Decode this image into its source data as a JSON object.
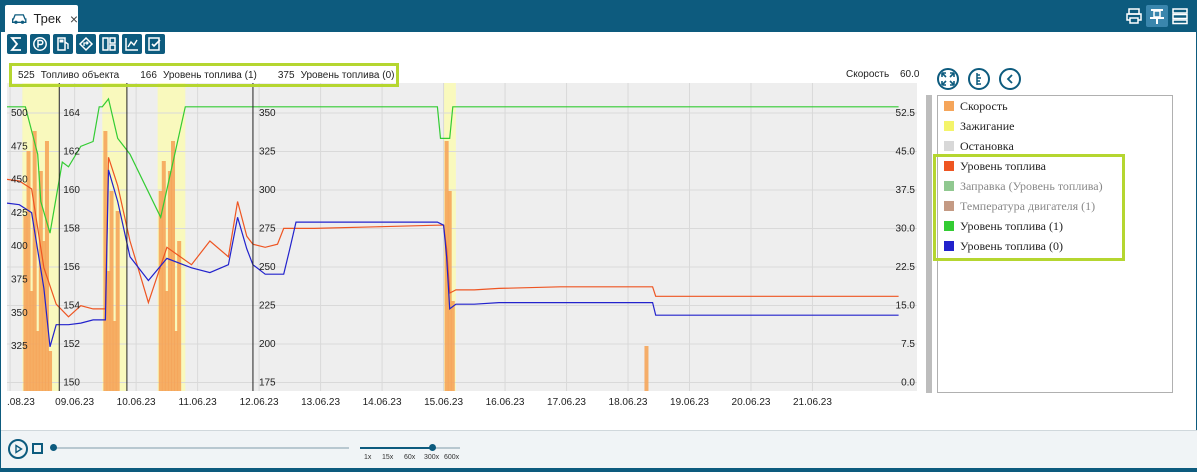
{
  "tab": {
    "title": "Трек",
    "close": "×"
  },
  "toolbar": {
    "buttons": [
      "sum-icon",
      "parking-icon",
      "fuel-icon",
      "route-icon",
      "layout-icon",
      "chart-icon",
      "report-icon"
    ]
  },
  "top_buttons": [
    "print-icon",
    "pin-icon",
    "list-icon"
  ],
  "top_legend": [
    {
      "value": "525",
      "label": "Топливо объекта"
    },
    {
      "value": "166",
      "label": "Уровень топлива (1)"
    },
    {
      "value": "375",
      "label": "Уровень топлива (0)"
    }
  ],
  "speed_axis_label": "Скорость",
  "speed_axis_max": "60.0",
  "panel_buttons": [
    "expand-icon",
    "scale-icon",
    "back-icon"
  ],
  "legend_items": [
    {
      "label": "Скорость",
      "color": "#f5a55a",
      "dim": false
    },
    {
      "label": "Зажигание",
      "color": "#f4f46a",
      "dim": false
    },
    {
      "label": "Остановка",
      "color": "#d8d8d8",
      "dim": false
    },
    {
      "label": "Уровень топлива",
      "color": "#ee5522",
      "dim": false
    },
    {
      "label": "Заправка (Уровень топлива)",
      "color": "#90c890",
      "dim": true
    },
    {
      "label": "Температура двигателя (1)",
      "color": "#c49a84",
      "dim": true
    },
    {
      "label": "Уровень топлива (1)",
      "color": "#33cc33",
      "dim": false
    },
    {
      "label": "Уровень топлива (0)",
      "color": "#2222cc",
      "dim": false
    }
  ],
  "player": {
    "speed_options": [
      "1x",
      "15x",
      "60x",
      "300x",
      "600x"
    ],
    "selected_speed": "300x"
  },
  "chart_data": {
    "type": "line",
    "x_tick_labels": [
      ".08.23",
      "09.06.23",
      "10.06.23",
      "11.06.23",
      "12.06.23",
      "13.06.23",
      "14.06.23",
      "15.06.23",
      "16.06.23",
      "17.06.23",
      "18.06.23",
      "19.06.23",
      "20.06.23",
      "21.06.23"
    ],
    "axes": [
      {
        "name": "Топливо объекта",
        "ticks": [
          "500",
          "475",
          "450",
          "425",
          "400",
          "375",
          "350",
          "325"
        ],
        "ylim": [
          320,
          510
        ]
      },
      {
        "name": "Уровень топлива (1)",
        "ticks": [
          "164",
          "162",
          "160",
          "158",
          "156",
          "154",
          "152",
          "150"
        ],
        "ylim": [
          149.5,
          165
        ]
      },
      {
        "name": "Уровень топлива (0)",
        "ticks": [
          "350",
          "325",
          "300",
          "275",
          "250",
          "225",
          "200",
          "175"
        ],
        "ylim": [
          170,
          360
        ]
      },
      {
        "name": "Скорость",
        "ticks": [
          "52.5",
          "45.0",
          "37.5",
          "30.0",
          "22.5",
          "15.0",
          "7.5",
          "0.0"
        ],
        "ylim": [
          0,
          60
        ]
      }
    ],
    "series": [
      {
        "name": "Уровень топлива",
        "color": "#ee5522",
        "axis": 2,
        "points": [
          [
            0,
            304
          ],
          [
            0.2,
            303
          ],
          [
            0.4,
            298
          ],
          [
            0.6,
            248
          ],
          [
            0.8,
            225
          ],
          [
            1.0,
            217
          ],
          [
            1.2,
            224
          ],
          [
            1.4,
            222
          ],
          [
            1.6,
            222
          ],
          [
            1.65,
            318
          ],
          [
            1.8,
            300
          ],
          [
            2.0,
            265
          ],
          [
            2.3,
            226
          ],
          [
            2.6,
            261
          ],
          [
            3.0,
            250
          ],
          [
            3.3,
            265
          ],
          [
            3.6,
            255
          ],
          [
            3.75,
            290
          ],
          [
            3.9,
            268
          ],
          [
            4.0,
            263
          ],
          [
            4.2,
            261
          ],
          [
            4.4,
            263
          ],
          [
            4.5,
            273
          ],
          [
            4.6,
            273
          ],
          [
            5.0,
            273
          ],
          [
            6.0,
            274
          ],
          [
            7.0,
            275
          ],
          [
            7.1,
            275
          ],
          [
            7.15,
            260
          ],
          [
            7.2,
            232
          ],
          [
            7.3,
            234
          ],
          [
            7.6,
            234
          ],
          [
            8.0,
            235
          ],
          [
            9.0,
            236
          ],
          [
            10.0,
            236
          ],
          [
            10.5,
            236
          ],
          [
            10.55,
            230
          ],
          [
            11.0,
            230
          ],
          [
            12.0,
            230
          ],
          [
            13.0,
            230
          ],
          [
            14.0,
            230
          ],
          [
            14.5,
            230
          ]
        ]
      },
      {
        "name": "Уровень топлива (1)",
        "color": "#33cc33",
        "axis": 0,
        "points": [
          [
            0,
            500
          ],
          [
            0.3,
            500
          ],
          [
            0.5,
            470
          ],
          [
            0.55,
            440
          ],
          [
            0.7,
            420
          ],
          [
            0.9,
            465
          ],
          [
            1.0,
            462
          ],
          [
            1.2,
            475
          ],
          [
            1.4,
            478
          ],
          [
            1.5,
            500
          ],
          [
            1.55,
            500
          ],
          [
            1.65,
            505
          ],
          [
            1.8,
            480
          ],
          [
            2.0,
            470
          ],
          [
            2.5,
            430
          ],
          [
            2.9,
            500
          ],
          [
            3.0,
            500
          ],
          [
            4.0,
            500
          ],
          [
            6.0,
            500
          ],
          [
            7.0,
            500
          ],
          [
            7.05,
            480
          ],
          [
            7.2,
            480
          ],
          [
            7.25,
            500
          ],
          [
            10.0,
            500
          ],
          [
            14.5,
            500
          ]
        ]
      },
      {
        "name": "Уровень топлива (0)",
        "color": "#2222cc",
        "axis": 2,
        "points": [
          [
            0,
            289
          ],
          [
            0.2,
            288
          ],
          [
            0.4,
            283
          ],
          [
            0.6,
            235
          ],
          [
            0.7,
            198
          ],
          [
            0.8,
            212
          ],
          [
            1.0,
            212
          ],
          [
            1.2,
            213
          ],
          [
            1.4,
            215
          ],
          [
            1.6,
            215
          ],
          [
            1.65,
            310
          ],
          [
            1.8,
            290
          ],
          [
            2.0,
            255
          ],
          [
            2.3,
            240
          ],
          [
            2.6,
            254
          ],
          [
            3.0,
            248
          ],
          [
            3.3,
            245
          ],
          [
            3.6,
            250
          ],
          [
            3.75,
            280
          ],
          [
            3.9,
            260
          ],
          [
            4.0,
            250
          ],
          [
            4.2,
            244
          ],
          [
            4.4,
            244
          ],
          [
            4.5,
            244
          ],
          [
            4.6,
            260
          ],
          [
            4.7,
            277
          ],
          [
            5.0,
            277
          ],
          [
            6.0,
            277
          ],
          [
            7.0,
            277
          ],
          [
            7.1,
            275
          ],
          [
            7.15,
            255
          ],
          [
            7.2,
            222
          ],
          [
            7.3,
            225
          ],
          [
            7.6,
            225
          ],
          [
            8.0,
            226
          ],
          [
            9.0,
            226
          ],
          [
            10.0,
            226
          ],
          [
            10.5,
            226
          ],
          [
            10.55,
            218
          ],
          [
            11.0,
            218
          ],
          [
            12.0,
            218
          ],
          [
            13.0,
            218
          ],
          [
            14.0,
            218
          ],
          [
            14.5,
            218
          ]
        ]
      }
    ],
    "speed_bars": {
      "color": "#f5a55a",
      "axis": 3,
      "points": [
        [
          0.3,
          35
        ],
        [
          0.35,
          48
        ],
        [
          0.4,
          20
        ],
        [
          0.45,
          52
        ],
        [
          0.5,
          12
        ],
        [
          0.55,
          44
        ],
        [
          0.6,
          30
        ],
        [
          0.65,
          50
        ],
        [
          0.7,
          8
        ],
        [
          1.6,
          52
        ],
        [
          1.65,
          24
        ],
        [
          1.7,
          40
        ],
        [
          1.75,
          14
        ],
        [
          1.8,
          36
        ],
        [
          2.5,
          40
        ],
        [
          2.55,
          46
        ],
        [
          2.6,
          20
        ],
        [
          2.65,
          44
        ],
        [
          2.7,
          50
        ],
        [
          2.75,
          12
        ],
        [
          2.8,
          30
        ],
        [
          7.15,
          50
        ],
        [
          7.2,
          40
        ],
        [
          7.25,
          18
        ],
        [
          10.4,
          9
        ]
      ]
    },
    "ignition_bands": [
      [
        0.25,
        0.85
      ],
      [
        1.55,
        1.95
      ],
      [
        2.45,
        2.9
      ],
      [
        7.1,
        7.3
      ]
    ],
    "axis_separators": [
      0.85,
      1.95,
      4.0
    ],
    "grid": true,
    "legend": "top-left"
  }
}
